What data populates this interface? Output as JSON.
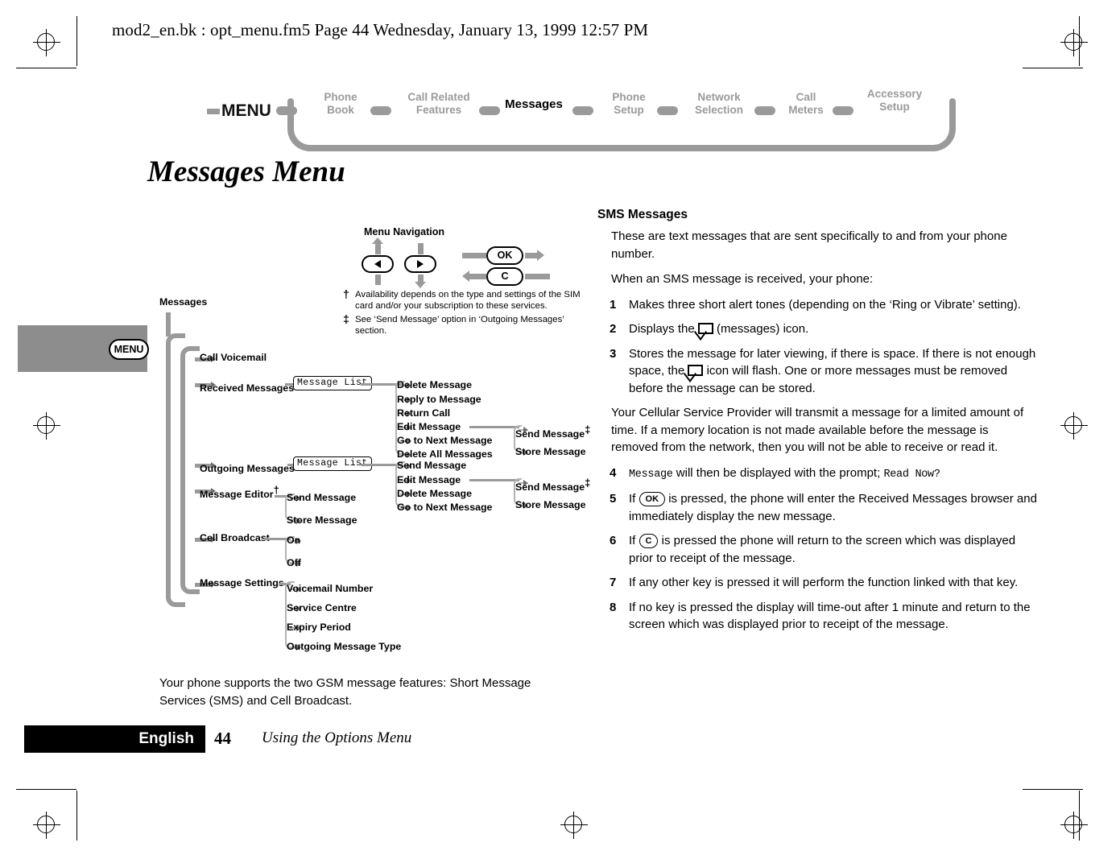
{
  "header": {
    "file_line": "mod2_en.bk : opt_menu.fm5  Page 44  Wednesday, January 13, 1999  12:57 PM"
  },
  "breadcrumb": {
    "root_label": "MENU",
    "items": [
      {
        "label": "Phone\nBook",
        "line1": "Phone",
        "line2": "Book",
        "active": false
      },
      {
        "label": "Call Related Features",
        "line1": "Call Related",
        "line2": "Features",
        "active": false
      },
      {
        "label": "Messages",
        "line1": "Messages",
        "line2": "",
        "active": true
      },
      {
        "label": "Phone Setup",
        "line1": "Phone",
        "line2": "Setup",
        "active": false
      },
      {
        "label": "Network Selection",
        "line1": "Network",
        "line2": "Selection",
        "active": false
      },
      {
        "label": "Call Meters",
        "line1": "Call",
        "line2": "Meters",
        "active": false
      },
      {
        "label": "Accessory Setup",
        "line1": "Accessory",
        "line2": "Setup",
        "active": false
      }
    ]
  },
  "page_title": "Messages Menu",
  "side_tab": {
    "key_label": "MENU"
  },
  "legend": {
    "title": "Menu Navigation",
    "ok_label": "OK",
    "c_label": "C",
    "footnotes": [
      {
        "mark": "†",
        "text": "Availability depends on the type and settings of the SIM card and/or your subscription to these services."
      },
      {
        "mark": "‡",
        "text": "See ‘Send Message’ option in ‘Outgoing Messages’ section."
      }
    ]
  },
  "tree": {
    "root": "Messages",
    "nodes": [
      {
        "label": "Call Voicemail",
        "dagger": ""
      },
      {
        "label": "Received Messages",
        "dagger": "†",
        "lcd": "Message List"
      },
      {
        "label": "Outgoing Messages",
        "dagger": "†",
        "lcd": "Message List"
      },
      {
        "label": "Message Editor",
        "dagger": "†"
      },
      {
        "label": "Cell Broadcast",
        "dagger": ""
      },
      {
        "label": "Message Settings",
        "dagger": ""
      }
    ],
    "received_sub": [
      "Delete Message",
      "Reply to Message",
      "Return Call",
      "Edit Message",
      "Go to Next Message",
      "Delete All Messages"
    ],
    "received_edit_sub": [
      {
        "label": "Send Message",
        "dagger": "‡"
      },
      {
        "label": "Store Message",
        "dagger": ""
      }
    ],
    "outgoing_sub": [
      "Send Message",
      "Edit Message",
      "Delete Message",
      "Go to Next Message"
    ],
    "outgoing_edit_sub": [
      {
        "label": "Send Message",
        "dagger": "‡"
      },
      {
        "label": "Store Message",
        "dagger": ""
      }
    ],
    "editor_sub": [
      "Send Message",
      "Store Message"
    ],
    "broadcast_sub": [
      "On",
      "Off"
    ],
    "settings_sub": [
      "Voicemail Number",
      "Service Centre",
      "Expiry Period",
      "Outgoing Message Type"
    ]
  },
  "left_paragraph": "Your phone supports the two GSM message features: Short Message Services (SMS) and Cell Broadcast.",
  "sms": {
    "heading": "SMS Messages",
    "intro1": "These are text messages that are sent specifically to and from your phone number.",
    "intro2": "When an SMS message is received, your phone:",
    "step1_num": "1",
    "step1": "Makes three short alert tones (depending on the ‘Ring or Vibrate’ setting).",
    "step2_num": "2",
    "step2_a": "Displays the",
    "step2_b": "(messages) icon.",
    "step3_num": "3",
    "step3_a": "Stores the message for later viewing, if there is space. If there is not enough space, the",
    "step3_b": "icon will flash. One or more messages must be removed before the message can be stored.",
    "mid_para": "Your Cellular Service Provider will transmit a message for a limited amount of time. If a memory location is not made available before the message is removed from the network, then you will not be able to receive or read it.",
    "step4_num": "4",
    "step4_lcd1": "Message",
    "step4_mid": "will then be displayed with the prompt;",
    "step4_lcd2": "Read Now?",
    "step5_num": "5",
    "step5_a": "If",
    "step5_key": "OK",
    "step5_b": "is pressed, the phone will enter the Received Messages browser and immediately display the new message.",
    "step6_num": "6",
    "step6_a": "If",
    "step6_key": "C",
    "step6_b": "is pressed the phone will return to the screen which was displayed prior to receipt of the message.",
    "step7_num": "7",
    "step7": "If any other key is pressed it will perform the function linked with that key.",
    "step8_num": "8",
    "step8": "If no key is pressed the display will time-out after 1 minute and return to the screen which was displayed prior to receipt of the message."
  },
  "footer": {
    "language": "English",
    "page_number": "44",
    "section": "Using the Options Menu"
  }
}
